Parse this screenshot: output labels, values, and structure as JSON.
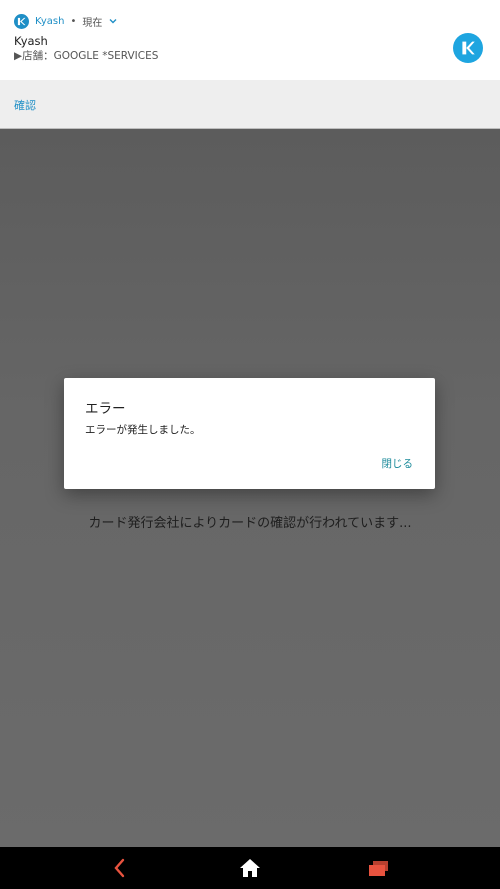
{
  "notification": {
    "app_name": "Kyash",
    "separator": "•",
    "time": "現在",
    "title": "Kyash",
    "text": "▶店舗：GOOGLE *SERVICES",
    "accent_color": "#1f8fc6",
    "icon": "kyash-logo-icon"
  },
  "actions": {
    "confirm_label": "確認"
  },
  "background": {
    "status_text": "カード発行会社によりカードの確認が行われています..."
  },
  "dialog": {
    "title": "エラー",
    "message": "エラーが発生しました。",
    "close_label": "閉じる"
  },
  "navbar": {
    "back_icon": "back-arrow-icon",
    "home_icon": "home-icon",
    "recent_icon": "recent-apps-icon",
    "accent_color": "#e8533f"
  }
}
